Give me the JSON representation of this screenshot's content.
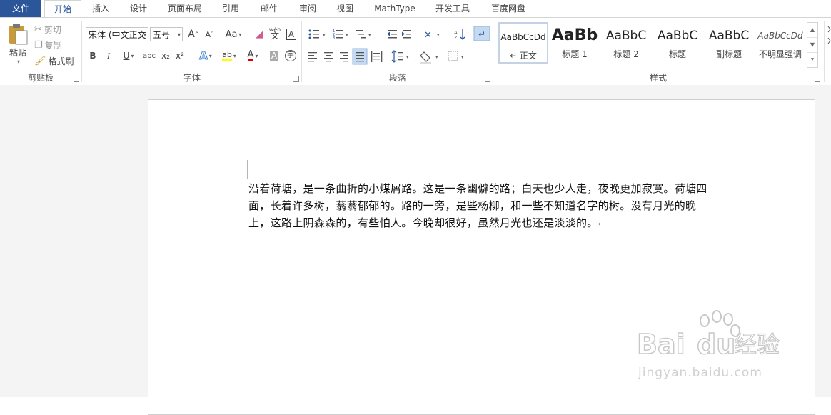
{
  "tabs": {
    "file": "文件",
    "home": "开始",
    "insert": "插入",
    "design": "设计",
    "layout": "页面布局",
    "references": "引用",
    "mailings": "邮件",
    "review": "审阅",
    "view": "视图",
    "mathtype": "MathType",
    "developer": "开发工具",
    "baidu": "百度网盘"
  },
  "clipboard": {
    "paste": "粘贴",
    "cut": "剪切",
    "copy": "复制",
    "format_painter": "格式刷",
    "label": "剪贴板"
  },
  "font": {
    "name": "宋体 (中文正文",
    "size": "五号",
    "label": "字体",
    "change_case": "Aa",
    "phonetic_top": "wén",
    "phonetic_char": "文",
    "bold": "B",
    "italic": "I",
    "underline": "U",
    "strike": "abc",
    "subscript": "x₂",
    "superscript": "x²",
    "char_border": "A",
    "shading": "A",
    "enclose": "字",
    "grow": "A",
    "shrink": "A",
    "text_effect": "A",
    "highlight": "ab",
    "font_color": "A"
  },
  "paragraph": {
    "label": "段落"
  },
  "styles": {
    "label": "样式",
    "items": [
      {
        "sample": "AaBbCcDd",
        "name": "↵ 正文"
      },
      {
        "sample": "AaBb",
        "name": "标题 1"
      },
      {
        "sample": "AaBbC",
        "name": "标题 2"
      },
      {
        "sample": "AaBbC",
        "name": "标题"
      },
      {
        "sample": "AaBbC",
        "name": "副标题"
      },
      {
        "sample": "AaBbCcDd",
        "name": "不明显强调"
      }
    ]
  },
  "document": {
    "paragraph": "沿着荷塘，是一条曲折的小煤屑路。这是一条幽僻的路；白天也少人走，夜晚更加寂寞。荷塘四面，长着许多树，蓊蓊郁郁的。路的一旁，是些杨柳，和一些不知道名字的树。没有月光的晚上，这路上阴森森的，有些怕人。今晚却很好，虽然月光也还是淡淡的。",
    "pilcrow": "↵"
  },
  "watermark": {
    "brand": "Bai",
    "brand2": "du",
    "cn": "经验",
    "url": "jingyan.baidu.com"
  },
  "colors": {
    "file_tab": "#2b579a",
    "highlight": "#ffff00",
    "font_color": "#e00000"
  }
}
